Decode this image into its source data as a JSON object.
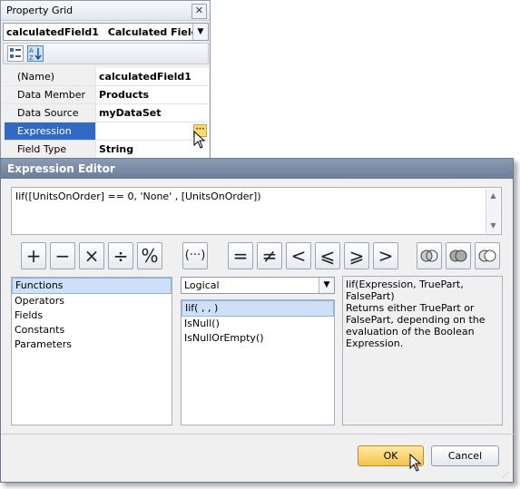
{
  "property_grid": {
    "title": "Property Grid",
    "close_glyph": "✕",
    "object_selector": {
      "name": "calculatedField1",
      "type": "Calculated Field"
    },
    "rows": [
      {
        "key": "(Name)",
        "value": "calculatedField1"
      },
      {
        "key": "Data Member",
        "value": "Products"
      },
      {
        "key": "Data Source",
        "value": "myDataSet"
      },
      {
        "key": "Expression",
        "value": ""
      },
      {
        "key": "Field Type",
        "value": "String"
      }
    ],
    "ellipsis_label": "···"
  },
  "expression_editor": {
    "title": "Expression Editor",
    "expression_text": "Iif([UnitsOnOrder] == 0, 'None' , [UnitsOnOrder])",
    "operators": [
      "+",
      "−",
      "×",
      "÷",
      "%",
      "(···)",
      "=",
      "≠",
      "<",
      "⩽",
      "⩾",
      ">"
    ],
    "logical_icons": [
      "and-icon",
      "or-icon",
      "not-icon"
    ],
    "categories": [
      "Functions",
      "Operators",
      "Fields",
      "Constants",
      "Parameters"
    ],
    "function_group": "Logical",
    "functions": [
      "Iif( , , )",
      "IsNull()",
      "IsNullOrEmpty()"
    ],
    "description": "Iif(Expression, TruePart, FalsePart)\nReturns either TruePart or FalsePart, depending on the evaluation of the Boolean Expression.",
    "ok_label": "OK",
    "cancel_label": "Cancel"
  }
}
